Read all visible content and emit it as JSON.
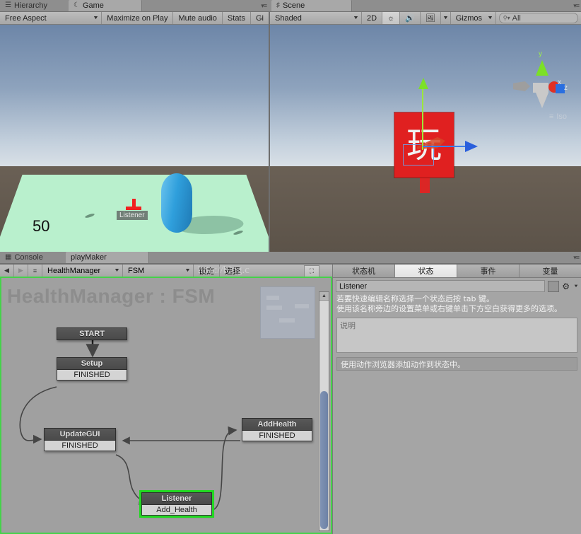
{
  "top_tabs": {
    "hierarchy": "Hierarchy",
    "game": "Game",
    "scene": "Scene"
  },
  "game_toolbar": {
    "aspect": "Free Aspect",
    "maximize": "Maximize on Play",
    "mute": "Mute audio",
    "stats": "Stats",
    "gizmos": "Gi"
  },
  "scene_toolbar": {
    "shading": "Shaded",
    "mode_2d": "2D",
    "gizmos": "Gizmos",
    "search_value": "All",
    "search_placeholder": "All"
  },
  "game_view": {
    "health_value": "50",
    "listener_label": "Listener"
  },
  "scene_view": {
    "object_glyph": "玩",
    "axis_x": "x",
    "axis_y": "y",
    "axis_z": "z",
    "projection": "Iso"
  },
  "bottom_tabs": {
    "console": "Console",
    "playmaker": "playMaker"
  },
  "pm_toolbar": {
    "back": "◀",
    "forward": "▶",
    "menu": "≡",
    "game_object": "HealthManager",
    "fsm": "FSM",
    "lock": "锁定",
    "select": "选择",
    "watermark": "http://blog.c"
  },
  "fsm_graph": {
    "title": "HealthManager : FSM",
    "nodes": [
      {
        "name": "START",
        "event": "",
        "selected": false
      },
      {
        "name": "Setup",
        "event": "FINISHED",
        "selected": false
      },
      {
        "name": "UpdateGUI",
        "event": "FINISHED",
        "selected": false
      },
      {
        "name": "AddHealth",
        "event": "FINISHED",
        "selected": false
      },
      {
        "name": "Listener",
        "event": "Add_Health",
        "selected": true
      }
    ]
  },
  "inspector": {
    "tabs": [
      {
        "label": "状态机",
        "active": false
      },
      {
        "label": "状态",
        "active": true
      },
      {
        "label": "事件",
        "active": false
      },
      {
        "label": "变量",
        "active": false
      }
    ],
    "state_name": "Listener",
    "hint_line1": "若要快速编辑名称选择一个状态后按 tab 键。",
    "hint_line2": "使用该名称旁边的设置菜单或右键单击下方空白获得更多的选项。",
    "description_placeholder": "说明",
    "info_bar": "使用动作浏览器添加动作到状态中。"
  },
  "colors": {
    "selection_green": "#22d822",
    "canvas_border": "#45d24a",
    "accent_red": "#e02020"
  }
}
